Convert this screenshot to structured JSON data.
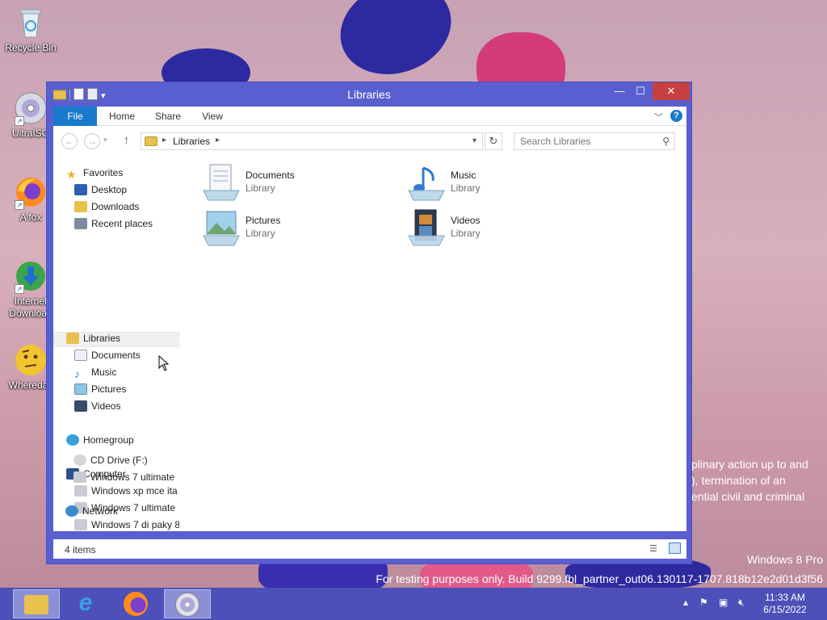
{
  "desktop": {
    "icons": [
      {
        "label": "Recycle Bin"
      },
      {
        "label": "UltraISO"
      },
      {
        "label": "A fox"
      },
      {
        "label": "Internet Download"
      },
      {
        "label": "Wheredac"
      }
    ],
    "legal_notice": [
      "plinary action up to and",
      "), termination of an",
      "ential civil and criminal"
    ],
    "watermark": {
      "edition": "Windows 8 Pro",
      "build": "For testing purposes only. Build 9299.fbl_partner_out06.130117-1707.818b12e2d01d3f56"
    }
  },
  "window": {
    "title": "Libraries",
    "ribbon_tabs": [
      "File",
      "Home",
      "Share",
      "View"
    ],
    "address": {
      "crumb": "Libraries"
    },
    "search": {
      "placeholder": "Search Libraries"
    },
    "nav": {
      "favorites": {
        "label": "Favorites",
        "items": [
          "Desktop",
          "Downloads",
          "Recent places"
        ]
      },
      "libraries": {
        "label": "Libraries",
        "items": [
          "Documents",
          "Music",
          "Pictures",
          "Videos"
        ]
      },
      "homegroup": {
        "label": "Homegroup"
      },
      "computer": {
        "label": "Computer",
        "items": [
          "Windows xp mce ita",
          "Windows 7 ultimate",
          "Windows 7 di paky 8",
          "CD Drive (F:)",
          "Windows 7 ultimate"
        ]
      },
      "network": {
        "label": "Network"
      }
    },
    "libraries": [
      {
        "name": "Documents",
        "type": "Library",
        "icon": "documents-library-icon"
      },
      {
        "name": "Music",
        "type": "Library",
        "icon": "music-library-icon"
      },
      {
        "name": "Pictures",
        "type": "Library",
        "icon": "pictures-library-icon"
      },
      {
        "name": "Videos",
        "type": "Library",
        "icon": "videos-library-icon"
      }
    ],
    "status": "4 items"
  },
  "taskbar": {
    "clock": {
      "time": "11:33 AM",
      "date": "6/15/2022"
    }
  },
  "colors": {
    "titlebar": "#5a5fd0",
    "taskbar": "#4c50b8",
    "file_tab": "#1979ca",
    "close": "#c73f3f"
  }
}
